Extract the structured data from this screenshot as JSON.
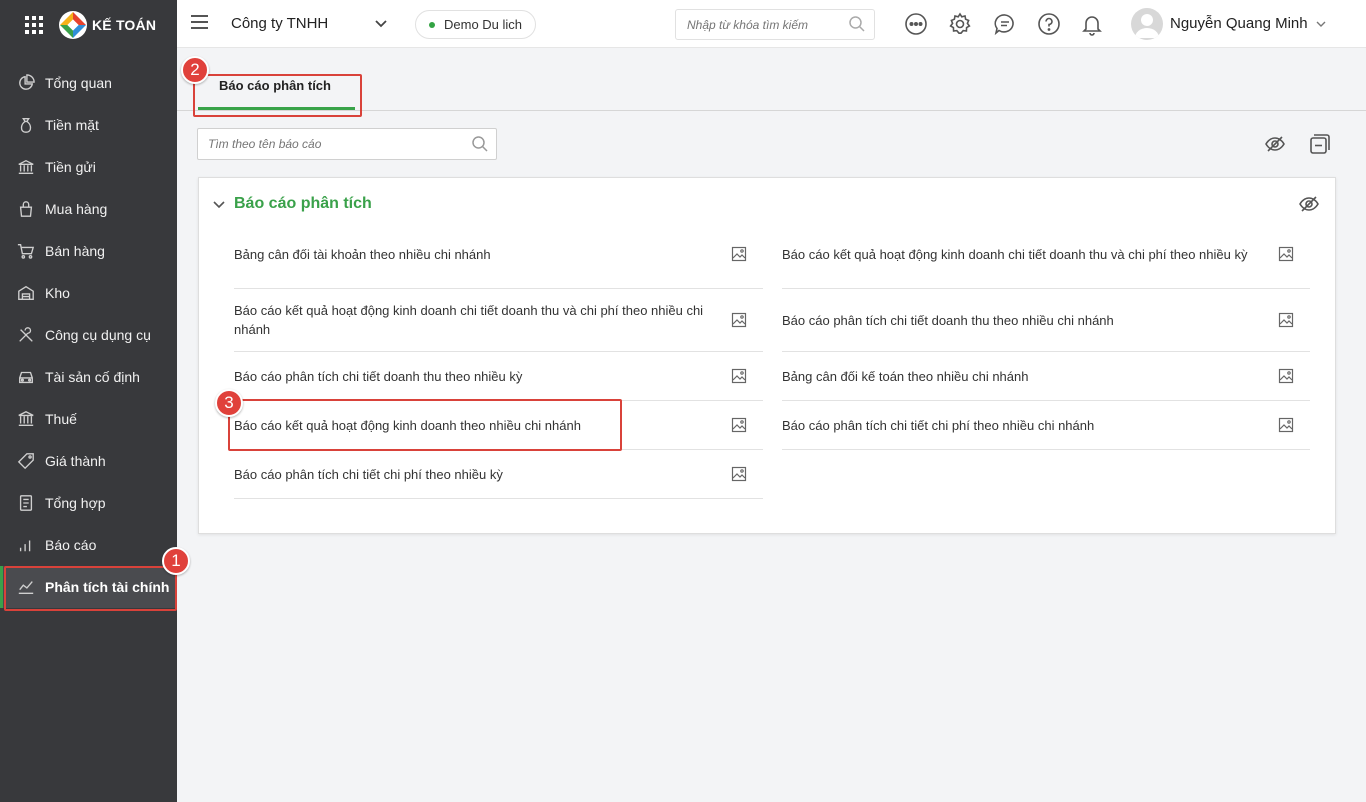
{
  "brand": {
    "name": "KẾ TOÁN"
  },
  "sidebar": {
    "items": [
      {
        "label": "Tổng quan",
        "icon": "chart-pie-icon"
      },
      {
        "label": "Tiền mặt",
        "icon": "money-bag-icon"
      },
      {
        "label": "Tiền gửi",
        "icon": "bank-icon"
      },
      {
        "label": "Mua hàng",
        "icon": "shopping-bag-icon"
      },
      {
        "label": "Bán hàng",
        "icon": "cart-icon"
      },
      {
        "label": "Kho",
        "icon": "warehouse-icon"
      },
      {
        "label": "Công cụ dụng cụ",
        "icon": "tools-icon"
      },
      {
        "label": "Tài sản cố định",
        "icon": "car-icon"
      },
      {
        "label": "Thuế",
        "icon": "institution-icon"
      },
      {
        "label": "Giá thành",
        "icon": "price-tag-icon"
      },
      {
        "label": "Tổng hợp",
        "icon": "ledger-icon"
      },
      {
        "label": "Báo cáo",
        "icon": "bar-chart-icon"
      },
      {
        "label": "Phân tích tài chính",
        "icon": "line-chart-icon",
        "active": true
      }
    ]
  },
  "header": {
    "company": "Công ty TNHH",
    "demo": "Demo Du lich",
    "search_placeholder": "Nhập từ khóa tìm kiếm",
    "user_name": "Nguyễn Quang Minh"
  },
  "main": {
    "tab_label": "Báo cáo phân tích",
    "report_search_placeholder": "Tìm theo tên báo cáo",
    "section_title": "Báo cáo phân tích",
    "reports_left": [
      "Bảng cân đối tài khoản theo nhiều chi nhánh",
      "Báo cáo kết quả hoạt động kinh doanh chi tiết doanh thu và chi phí theo nhiều chi nhánh",
      "Báo cáo phân tích chi tiết doanh thu theo nhiều kỳ",
      "Báo cáo kết quả hoạt động kinh doanh theo nhiều chi nhánh",
      "Báo cáo phân tích chi tiết chi phí theo nhiều kỳ"
    ],
    "reports_right": [
      "Báo cáo kết quả hoạt động kinh doanh chi tiết doanh thu và chi phí theo nhiều kỳ",
      "Báo cáo phân tích chi tiết doanh thu theo nhiều chi nhánh",
      "Bảng cân đối kế toán theo nhiều chi nhánh",
      "Báo cáo phân tích chi tiết chi phí theo nhiều chi nhánh"
    ]
  },
  "annotations": {
    "step1": "1",
    "step2": "2",
    "step3": "3"
  },
  "colors": {
    "accent_green": "#3aa14a",
    "annotation_red": "#d9423a",
    "sidebar_bg": "#38393c"
  }
}
